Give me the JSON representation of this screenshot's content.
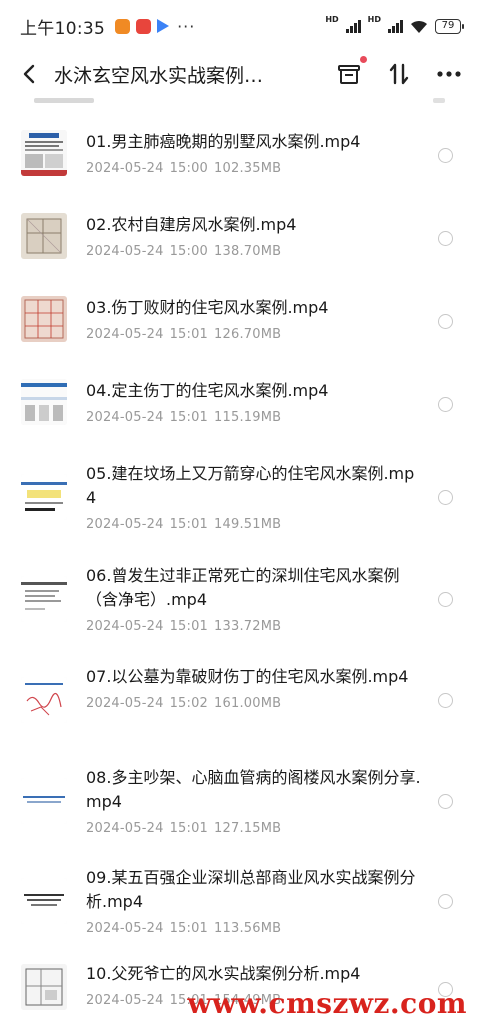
{
  "status": {
    "time": "上午10:35",
    "more": "···",
    "hd1": "HD",
    "hd2": "HD",
    "battery": "79"
  },
  "header": {
    "title": "水沐玄空风水实战案例…"
  },
  "files": [
    {
      "name": "01.男主肺癌晚期的别墅风水案例.mp4",
      "date": "2024-05-24",
      "time": "15:00",
      "size": "102.35MB"
    },
    {
      "name": "02.农村自建房风水案例.mp4",
      "date": "2024-05-24",
      "time": "15:00",
      "size": "138.70MB"
    },
    {
      "name": "03.伤丁败财的住宅风水案例.mp4",
      "date": "2024-05-24",
      "time": "15:01",
      "size": "126.70MB"
    },
    {
      "name": "04.定主伤丁的住宅风水案例.mp4",
      "date": "2024-05-24",
      "time": "15:01",
      "size": "115.19MB"
    },
    {
      "name": "05.建在坟场上又万箭穿心的住宅风水案例.mp4",
      "date": "2024-05-24",
      "time": "15:01",
      "size": "149.51MB"
    },
    {
      "name": "06.曾发生过非正常死亡的深圳住宅风水案例（含净宅）.mp4",
      "date": "2024-05-24",
      "time": "15:01",
      "size": "133.72MB"
    },
    {
      "name": "07.以公墓为靠破财伤丁的住宅风水案例.mp4",
      "date": "2024-05-24",
      "time": "15:02",
      "size": "161.00MB"
    },
    {
      "name": "08.多主吵架、心脑血管病的阁楼风水案例分享.mp4",
      "date": "2024-05-24",
      "time": "15:01",
      "size": "127.15MB"
    },
    {
      "name": "09.某五百强企业深圳总部商业风水实战案例分析.mp4",
      "date": "2024-05-24",
      "time": "15:01",
      "size": "113.56MB"
    },
    {
      "name": "10.父死爷亡的风水实战案例分析.mp4",
      "date": "2024-05-24",
      "time": "15:01",
      "size": "154.49MB"
    }
  ],
  "watermark": "www.cmszwz.com"
}
